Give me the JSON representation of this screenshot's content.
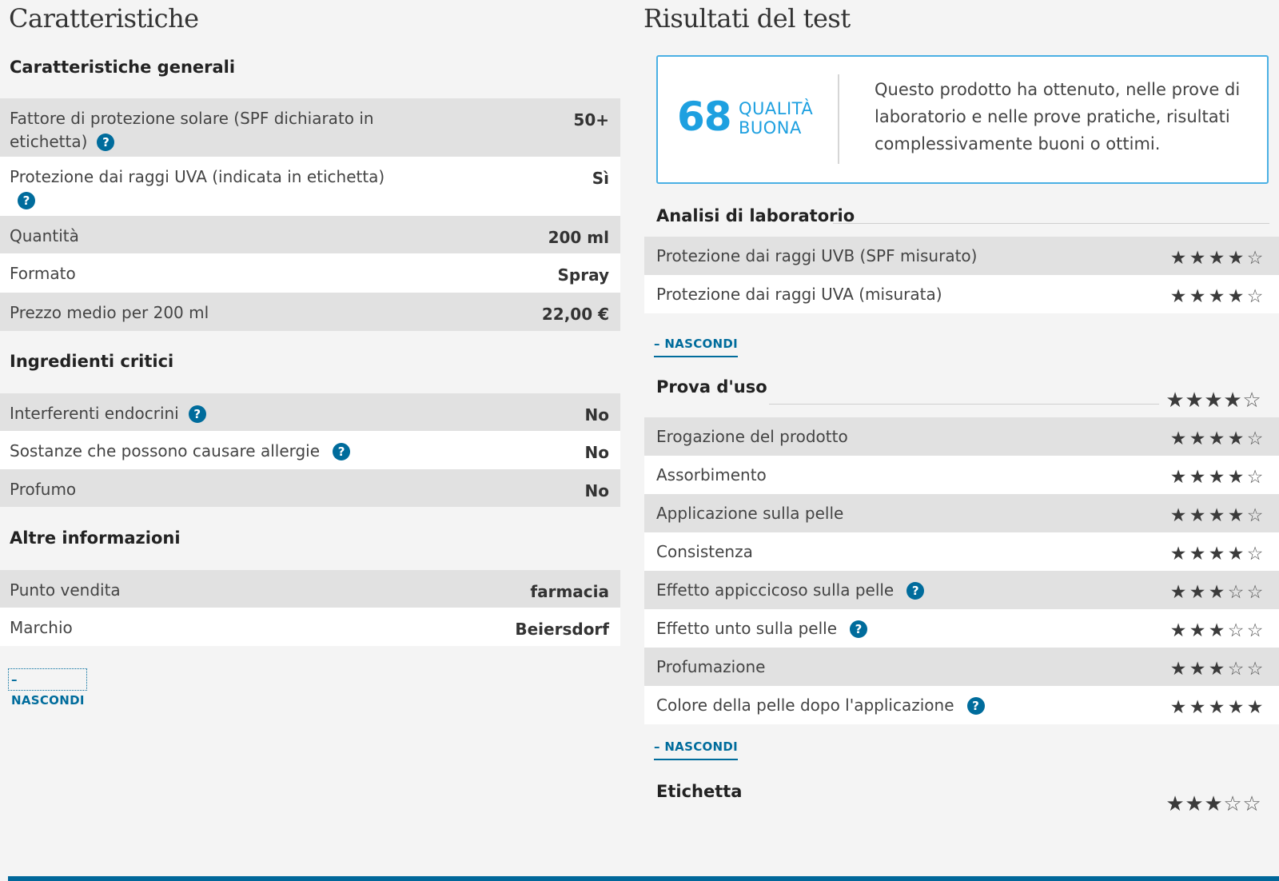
{
  "left": {
    "title": "Caratteristiche",
    "general": {
      "title": "Caratteristiche generali",
      "rows": [
        {
          "label": "Fattore di protezione solare (SPF dichiarato in etichetta)",
          "value": "50+"
        },
        {
          "label": "Protezione dai raggi UVA (indicata in etichetta)",
          "value": "Sì"
        },
        {
          "label": "Quantità",
          "value": "200 ml"
        },
        {
          "label": "Formato",
          "value": "Spray"
        },
        {
          "label": "Prezzo medio per 200 ml",
          "value": "22,00 €"
        }
      ]
    },
    "critical": {
      "title": "Ingredienti critici",
      "rows": [
        {
          "label": "Interferenti endocrini",
          "value": "No"
        },
        {
          "label": "Sostanze che possono causare allergie",
          "value": "No"
        },
        {
          "label": "Profumo",
          "value": "No"
        }
      ]
    },
    "other": {
      "title": "Altre informazioni",
      "rows": [
        {
          "label": "Punto vendita",
          "value": "farmacia"
        },
        {
          "label": "Marchio",
          "value": "Beiersdorf"
        }
      ]
    },
    "hide_link": "– NASCONDI"
  },
  "right": {
    "title": "Risultati del test",
    "score": {
      "value": "68",
      "quality_line1": "QUALITÀ",
      "quality_line2": "BUONA",
      "description": "Questo prodotto ha ottenuto, nelle prove di laboratorio e nelle prove pratiche, risultati complessivamente buoni o ottimi."
    },
    "lab": {
      "title": "Analisi di laboratorio",
      "rows": [
        {
          "label": "Protezione dai raggi UVB (SPF misurato)",
          "rating": 4
        },
        {
          "label": "Protezione dai raggi UVA (misurata)",
          "rating": 4
        }
      ],
      "hide_link": "– NASCONDI"
    },
    "use": {
      "title": "Prova d'uso",
      "rating": 4,
      "rows": [
        {
          "label": "Erogazione del prodotto",
          "rating": 4
        },
        {
          "label": "Assorbimento",
          "rating": 4
        },
        {
          "label": "Applicazione sulla pelle",
          "rating": 4
        },
        {
          "label": "Consistenza",
          "rating": 4
        },
        {
          "label": "Effetto appiccicoso sulla pelle",
          "rating": 3
        },
        {
          "label": "Effetto unto sulla pelle",
          "rating": 3
        },
        {
          "label": "Profumazione",
          "rating": 3
        },
        {
          "label": "Colore della pelle dopo l'applicazione",
          "rating": 5
        }
      ],
      "hide_link": "– NASCONDI"
    },
    "label_section": {
      "title": "Etichetta",
      "rating": 3
    },
    "max_rating": 5
  },
  "icons": {
    "help": "question-icon",
    "star_full": "star-filled-icon",
    "star_empty": "star-outline-icon"
  },
  "colors": {
    "accent": "#006c9c",
    "score": "#1ea0e0",
    "row_shaded": "#e1e1e1",
    "background": "#f4f4f4"
  }
}
